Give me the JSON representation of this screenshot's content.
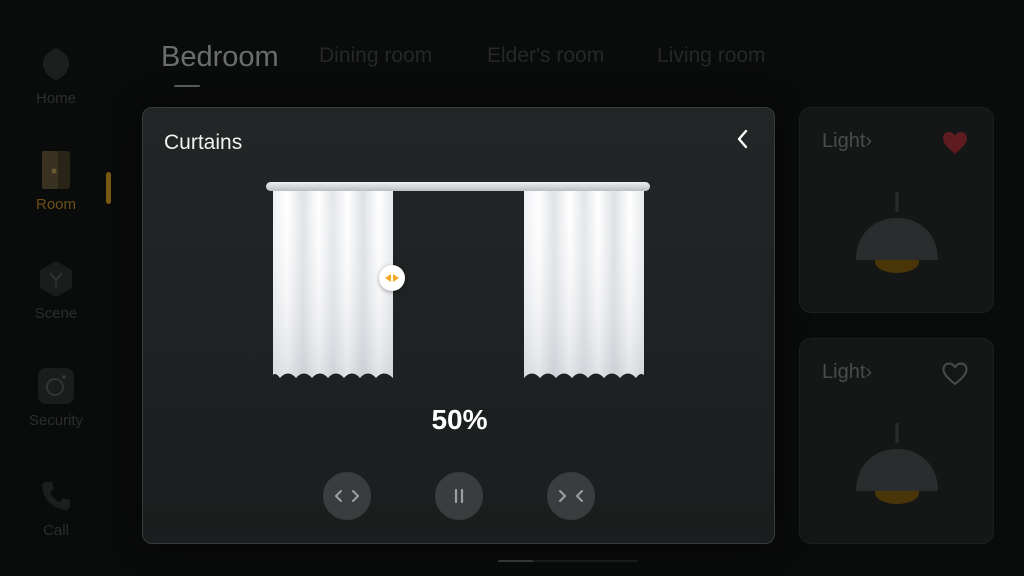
{
  "sidebar": {
    "items": [
      {
        "label": "Home",
        "icon": "home-icon",
        "active": false
      },
      {
        "label": "Room",
        "icon": "room-icon",
        "active": true
      },
      {
        "label": "Scene",
        "icon": "scene-icon",
        "active": false
      },
      {
        "label": "Security",
        "icon": "security-icon",
        "active": false
      },
      {
        "label": "Call",
        "icon": "phone-icon",
        "active": false
      }
    ]
  },
  "tabs": [
    {
      "label": "Bedroom",
      "active": true
    },
    {
      "label": "Dining room",
      "active": false
    },
    {
      "label": "Elder's room",
      "active": false
    },
    {
      "label": "Living room",
      "active": false
    }
  ],
  "cards": [
    {
      "title": "Light",
      "chevron": "›",
      "favorite": true,
      "icon": "pendant-lamp-icon"
    },
    {
      "title": "Light",
      "chevron": "›",
      "favorite": false,
      "icon": "pendant-lamp-icon"
    }
  ],
  "modal": {
    "title": "Curtains",
    "back_icon": "chevron-left-icon",
    "open_percent_label": "50%",
    "open_fraction": 0.5,
    "controls": [
      {
        "name": "open-button",
        "icon": "chevron-out-icon"
      },
      {
        "name": "pause-button",
        "icon": "pause-icon"
      },
      {
        "name": "close-button",
        "icon": "chevron-in-icon"
      }
    ]
  },
  "colors": {
    "accent": "#f5a623",
    "favorite": "#c0303a",
    "background": "#0a0b0b",
    "modal": "#1e2222"
  }
}
